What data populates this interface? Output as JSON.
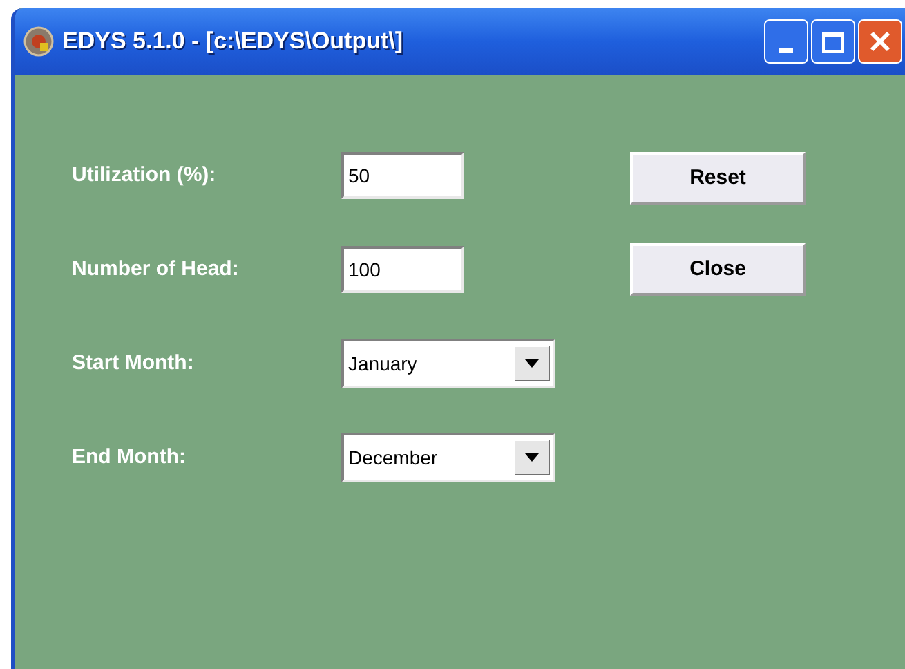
{
  "window": {
    "title": "EDYS 5.1.0 - [c:\\EDYS\\Output\\]"
  },
  "fields": [
    {
      "label": "Utilization (%):",
      "kind": "text",
      "value": "50"
    },
    {
      "label": "Number of Head:",
      "kind": "text",
      "value": "100"
    },
    {
      "label": "Start Month:",
      "kind": "dropdown",
      "value": "January"
    },
    {
      "label": "End Month:",
      "kind": "dropdown",
      "value": "December"
    }
  ],
  "buttons": [
    "Reset",
    "Close"
  ]
}
